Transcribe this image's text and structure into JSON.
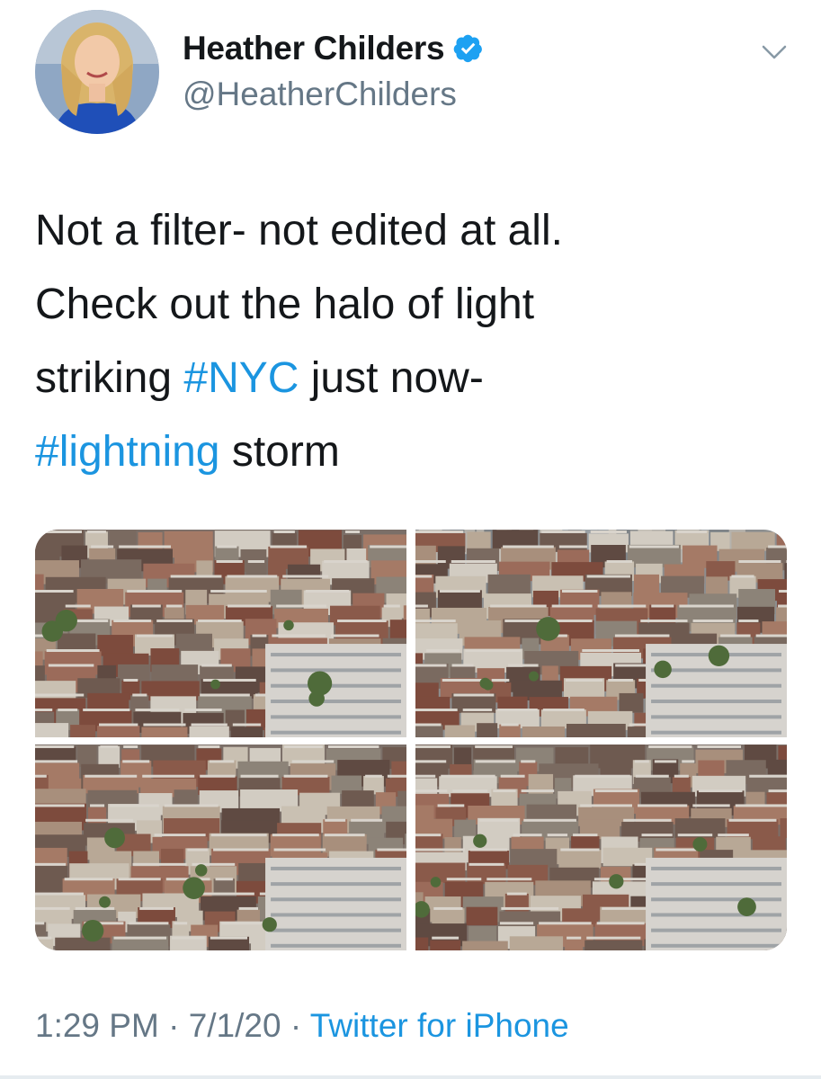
{
  "tweet": {
    "author": {
      "display_name": "Heather Childers",
      "handle": "@HeatherChilders",
      "verified": true,
      "verified_color": "#1da1f2"
    },
    "more_menu_icon": "chevron-down-icon",
    "text_lines": [
      {
        "segments": [
          {
            "text": "Not a filter- not edited at all.",
            "hashtag": false
          }
        ]
      },
      {
        "segments": [
          {
            "text": "Check out the halo of light",
            "hashtag": false
          }
        ]
      },
      {
        "segments": [
          {
            "text": "striking ",
            "hashtag": false
          },
          {
            "text": "#NYC",
            "hashtag": true
          },
          {
            "text": " just now-",
            "hashtag": false
          }
        ]
      },
      {
        "segments": [
          {
            "text": "#lightning",
            "hashtag": true
          },
          {
            "text": " storm",
            "hashtag": false
          }
        ]
      }
    ],
    "media": [
      {
        "name": "photo-1",
        "description": "aerial city photo"
      },
      {
        "name": "photo-2",
        "description": "aerial city photo"
      },
      {
        "name": "photo-3",
        "description": "aerial city photo"
      },
      {
        "name": "photo-4",
        "description": "aerial city photo"
      }
    ],
    "meta": {
      "time": "1:29 PM",
      "separator": " · ",
      "date": "7/1/20",
      "source": "Twitter for iPhone"
    },
    "colors": {
      "link": "#1b95e0",
      "secondary_text": "#657786",
      "primary_text": "#14171a"
    }
  }
}
